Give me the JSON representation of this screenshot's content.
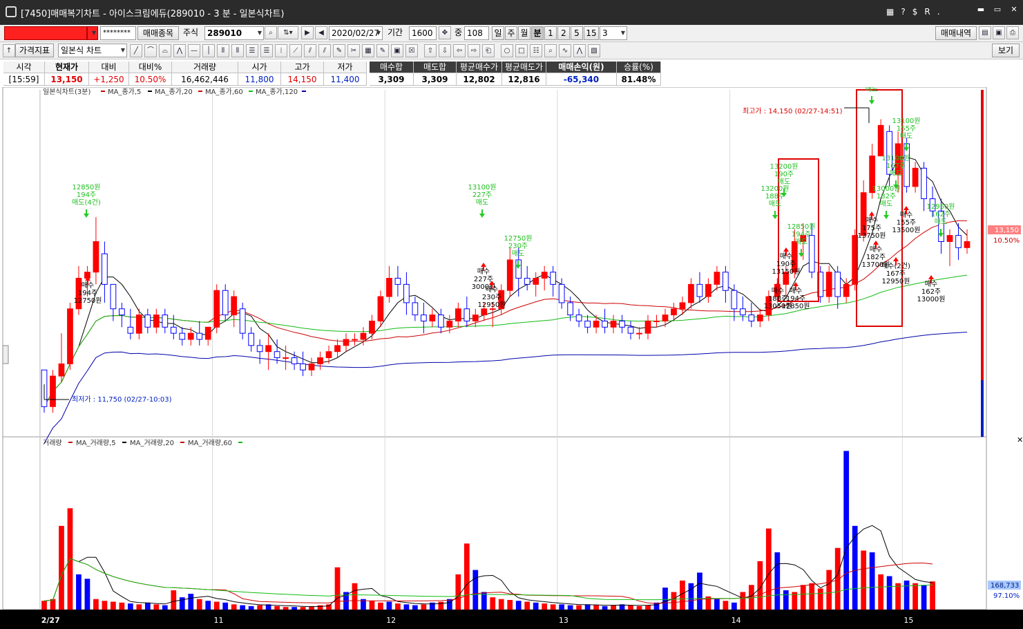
{
  "window": {
    "title": "[7450]매매복기차트 - 아이스크림에듀(289010 - 3 분 - 일본식차트)",
    "tb_icons": [
      "▦",
      "?",
      "$",
      "R",
      "."
    ],
    "controls": [
      "▬",
      "▭",
      "✕"
    ]
  },
  "toolbar1": {
    "password_mask": "********",
    "trade_item_button": "매매종목",
    "market_label": "주식",
    "code": "289010",
    "date": "2020/02/27",
    "period_label": "기간",
    "period_value": "1600",
    "overlap_label": "중",
    "overlap_value": "108",
    "units": [
      "일",
      "주",
      "월",
      "분",
      "1",
      "2",
      "5",
      "15",
      "3"
    ],
    "active_unit": "분",
    "history_button": "매매내역"
  },
  "toolbar2": {
    "indicator_button": "가격지표",
    "chart_type": "일본식 차트",
    "view_button": "보기"
  },
  "info_table": {
    "headers": [
      "시각",
      "현재가",
      "대비",
      "대비%",
      "거래량",
      "시가",
      "고가",
      "저가",
      "매수합",
      "매도합",
      "평균매수가",
      "평균매도가",
      "매매손익(원)",
      "승률(%)"
    ],
    "values": [
      "[15:59]",
      "13,150",
      "+1,250",
      "10.50%",
      "16,462,446",
      "11,800",
      "14,150",
      "11,400",
      "3,309",
      "3,309",
      "12,802",
      "12,816",
      "-65,340",
      "81.48%"
    ]
  },
  "price_legend": {
    "chart": "일본식차트(3분)",
    "ma": [
      "MA_종가,5",
      "MA_종가,20",
      "MA_종가,60",
      "MA_종가,120"
    ]
  },
  "volume_legend": {
    "chart": "거래량",
    "ma": [
      "MA_거래량,5",
      "MA_거래량,20",
      "MA_거래량,60"
    ]
  },
  "price_markers": {
    "high": "최고가 : 14,150 (02/27-14:51)",
    "low": "최저가 : 11,750 (02/27-10:03)",
    "current_price": "13,150",
    "current_pct": "10.50%"
  },
  "volume_markers": {
    "value": "168,733",
    "pct": "97.10%"
  },
  "x_axis_labels": [
    "2/27",
    "11",
    "12",
    "13",
    "14",
    "15"
  ],
  "annotations": [
    {
      "type": "sell",
      "lines": [
        "12850원",
        "194주",
        "매도(4건)"
      ]
    },
    {
      "type": "buy",
      "lines": [
        "매수",
        "194주",
        "12750원"
      ]
    },
    {
      "type": "sell",
      "lines": [
        "13100원",
        "227주",
        "매도"
      ]
    },
    {
      "type": "sell",
      "lines": [
        "12750원",
        "230주",
        "매도"
      ]
    },
    {
      "type": "buy",
      "lines": [
        "매수",
        "227주",
        "3000원"
      ]
    },
    {
      "type": "buy",
      "lines": [
        "매수",
        "230주",
        "12950원"
      ]
    },
    {
      "type": "sell",
      "lines": [
        "13200원",
        "190주",
        "매도"
      ]
    },
    {
      "type": "sell",
      "lines": [
        "13200원",
        "188주",
        "매도"
      ]
    },
    {
      "type": "sell",
      "lines": [
        "12850원",
        "194주",
        "매도"
      ]
    },
    {
      "type": "buy",
      "lines": [
        "매수",
        "190주",
        "13150원"
      ]
    },
    {
      "type": "buy",
      "lines": [
        "매수",
        "188주",
        "13050원"
      ]
    },
    {
      "type": "buy",
      "lines": [
        "매수",
        "194주",
        "12850원"
      ]
    },
    {
      "type": "sell",
      "lines": [
        "매도"
      ]
    },
    {
      "type": "sell",
      "lines": [
        "13100원",
        "155주",
        "매도"
      ]
    },
    {
      "type": "sell",
      "lines": [
        "13100원",
        "167주",
        "매도"
      ]
    },
    {
      "type": "sell",
      "lines": [
        "13000원",
        "182주",
        "매도"
      ]
    },
    {
      "type": "sell",
      "lines": [
        "12950원",
        "162주",
        "매도"
      ]
    },
    {
      "type": "buy",
      "lines": [
        "매수",
        "175주",
        "13750원"
      ]
    },
    {
      "type": "buy",
      "lines": [
        "매수",
        "182주",
        "13700원"
      ]
    },
    {
      "type": "buy",
      "lines": [
        "매수",
        "155주",
        "13500원"
      ]
    },
    {
      "type": "buy",
      "lines": [
        "매수(2건)",
        "167주",
        "12950원"
      ]
    },
    {
      "type": "buy",
      "lines": [
        "매수",
        "162주",
        "13000원"
      ]
    }
  ],
  "colors": {
    "up": "#ff0000",
    "down": "#0000ff",
    "ma5": "#000000",
    "ma20": "#cc0000",
    "ma60": "#11bb11",
    "ma120": "#0000aa",
    "buy_arrow": "#ff0000",
    "sell_arrow": "#22cc22"
  },
  "chart_data": [
    {
      "type": "candlestick",
      "title": "일본식차트(3분)",
      "ylim": [
        11700,
        14300
      ],
      "x_labels": [
        "2/27",
        "11",
        "12",
        "13",
        "14",
        "15"
      ],
      "series": [
        {
          "name": "MA_종가,5"
        },
        {
          "name": "MA_종가,20"
        },
        {
          "name": "MA_종가,60"
        },
        {
          "name": "MA_종가,120"
        }
      ],
      "ohlc": [
        [
          12100,
          12100,
          11750,
          11800
        ],
        [
          11800,
          12100,
          11750,
          12050
        ],
        [
          12050,
          12400,
          12000,
          12150
        ],
        [
          12150,
          12650,
          12100,
          12600
        ],
        [
          12600,
          12950,
          12550,
          12850
        ],
        [
          12850,
          12950,
          12700,
          12900
        ],
        [
          12900,
          13350,
          12800,
          13150
        ],
        [
          13050,
          13150,
          12650,
          12800
        ],
        [
          12800,
          12800,
          12500,
          12600
        ],
        [
          12600,
          12650,
          12450,
          12550
        ],
        [
          12450,
          12600,
          12350,
          12400
        ],
        [
          12400,
          12600,
          12350,
          12550
        ],
        [
          12550,
          12600,
          12400,
          12450
        ],
        [
          12450,
          12600,
          12400,
          12550
        ],
        [
          12550,
          12600,
          12400,
          12450
        ],
        [
          12450,
          12550,
          12350,
          12400
        ],
        [
          12400,
          12450,
          12300,
          12350
        ],
        [
          12350,
          12450,
          12300,
          12400
        ],
        [
          12400,
          12500,
          12300,
          12350
        ],
        [
          12350,
          12450,
          12300,
          12450
        ],
        [
          12450,
          12800,
          12400,
          12750
        ],
        [
          12750,
          12800,
          12500,
          12550
        ],
        [
          12550,
          12750,
          12450,
          12700
        ],
        [
          12600,
          12650,
          12350,
          12400
        ],
        [
          12400,
          12450,
          12250,
          12300
        ],
        [
          12300,
          12350,
          12150,
          12250
        ],
        [
          12250,
          12400,
          12100,
          12300
        ],
        [
          12250,
          12350,
          12150,
          12200
        ],
        [
          12200,
          12300,
          12100,
          12200
        ],
        [
          12200,
          12250,
          12100,
          12150
        ],
        [
          12150,
          12250,
          12050,
          12100
        ],
        [
          12100,
          12200,
          12050,
          12150
        ],
        [
          12150,
          12250,
          12100,
          12200
        ],
        [
          12200,
          12300,
          12150,
          12250
        ],
        [
          12250,
          12350,
          12200,
          12300
        ],
        [
          12300,
          12400,
          12250,
          12350
        ],
        [
          12350,
          12400,
          12300,
          12350
        ],
        [
          12350,
          12450,
          12300,
          12400
        ],
        [
          12400,
          12550,
          12350,
          12500
        ],
        [
          12500,
          12750,
          12450,
          12700
        ],
        [
          12700,
          12950,
          12650,
          12850
        ],
        [
          12850,
          12950,
          12700,
          12800
        ],
        [
          12800,
          12900,
          12550,
          12650
        ],
        [
          12650,
          12700,
          12500,
          12550
        ],
        [
          12550,
          12650,
          12400,
          12500
        ],
        [
          12500,
          12600,
          12450,
          12550
        ],
        [
          12550,
          12600,
          12400,
          12450
        ],
        [
          12450,
          12550,
          12400,
          12500
        ],
        [
          12500,
          12650,
          12450,
          12600
        ],
        [
          12600,
          12700,
          12450,
          12500
        ],
        [
          12500,
          12600,
          12450,
          12550
        ],
        [
          12550,
          12650,
          12500,
          12600
        ],
        [
          12600,
          12650,
          12450,
          12600
        ],
        [
          12600,
          12800,
          12550,
          12750
        ],
        [
          12750,
          13100,
          12700,
          13000
        ],
        [
          13000,
          13100,
          12700,
          12850
        ],
        [
          12850,
          12950,
          12750,
          12800
        ],
        [
          12800,
          12900,
          12700,
          12850
        ],
        [
          12850,
          12950,
          12750,
          12900
        ],
        [
          12900,
          12950,
          12700,
          12800
        ],
        [
          12800,
          12850,
          12600,
          12650
        ],
        [
          12650,
          12700,
          12500,
          12550
        ],
        [
          12550,
          12600,
          12450,
          12500
        ],
        [
          12500,
          12550,
          12400,
          12450
        ],
        [
          12450,
          12550,
          12400,
          12500
        ],
        [
          12500,
          12600,
          12400,
          12450
        ],
        [
          12450,
          12550,
          12400,
          12500
        ],
        [
          12500,
          12550,
          12400,
          12450
        ],
        [
          12450,
          12500,
          12350,
          12400
        ],
        [
          12400,
          12450,
          12350,
          12400
        ],
        [
          12400,
          12550,
          12350,
          12500
        ],
        [
          12500,
          12550,
          12450,
          12500
        ],
        [
          12500,
          12600,
          12450,
          12550
        ],
        [
          12550,
          12650,
          12500,
          12600
        ],
        [
          12600,
          12700,
          12550,
          12650
        ],
        [
          12650,
          12850,
          12600,
          12800
        ],
        [
          12800,
          12900,
          12650,
          12700
        ],
        [
          12700,
          12850,
          12650,
          12800
        ],
        [
          12800,
          12950,
          12750,
          12900
        ],
        [
          12900,
          12950,
          12650,
          12750
        ],
        [
          12750,
          12800,
          12500,
          12600
        ],
        [
          12600,
          12700,
          12500,
          12550
        ],
        [
          12550,
          12650,
          12450,
          12500
        ],
        [
          12500,
          12600,
          12450,
          12550
        ],
        [
          12550,
          12750,
          12500,
          12700
        ],
        [
          12700,
          12850,
          12650,
          12800
        ],
        [
          12800,
          12950,
          12700,
          12900
        ],
        [
          12900,
          13250,
          12850,
          13150
        ],
        [
          13150,
          13300,
          13000,
          13200
        ],
        [
          13200,
          13300,
          12850,
          12900
        ],
        [
          12900,
          12950,
          12650,
          12700
        ],
        [
          12700,
          12950,
          12650,
          12900
        ],
        [
          12900,
          12950,
          12600,
          12700
        ],
        [
          12700,
          12850,
          12650,
          12800
        ],
        [
          12800,
          13250,
          12750,
          13200
        ],
        [
          13200,
          13650,
          13150,
          13550
        ],
        [
          13550,
          13950,
          13500,
          13850
        ],
        [
          13850,
          14150,
          13850,
          14100
        ],
        [
          14050,
          14100,
          13600,
          13700
        ],
        [
          13700,
          14050,
          13550,
          13950
        ],
        [
          13950,
          14000,
          13550,
          13600
        ],
        [
          13600,
          13800,
          13550,
          13750
        ],
        [
          13750,
          13800,
          13400,
          13500
        ],
        [
          13500,
          13600,
          13350,
          13400
        ],
        [
          13400,
          13500,
          13050,
          13150
        ],
        [
          13150,
          13250,
          12950,
          13200
        ],
        [
          13200,
          13300,
          13000,
          13100
        ],
        [
          13100,
          13250,
          13050,
          13150
        ]
      ]
    },
    {
      "type": "bar",
      "title": "거래량",
      "series": [
        {
          "name": "MA_거래량,5"
        },
        {
          "name": "MA_거래량,20"
        },
        {
          "name": "MA_거래량,60"
        }
      ],
      "values": [
        10,
        12,
        95,
        115,
        40,
        35,
        12,
        10,
        9,
        8,
        7,
        6,
        8,
        6,
        5,
        22,
        14,
        18,
        12,
        10,
        9,
        8,
        6,
        5,
        4,
        5,
        6,
        4,
        3,
        3,
        3,
        4,
        5,
        6,
        48,
        20,
        30,
        12,
        10,
        8,
        9,
        7,
        6,
        5,
        6,
        8,
        9,
        12,
        40,
        75,
        45,
        20,
        14,
        12,
        11,
        10,
        9,
        8,
        7,
        6,
        6,
        5,
        5,
        6,
        5,
        4,
        5,
        6,
        5,
        4,
        5,
        8,
        25,
        20,
        33,
        30,
        42,
        15,
        12,
        10,
        8,
        20,
        28,
        55,
        92,
        65,
        22,
        20,
        28,
        30,
        24,
        45,
        70,
        180,
        95,
        67,
        65,
        40,
        38,
        30,
        33,
        30,
        28,
        32
      ],
      "up": [
        1,
        1,
        1,
        1,
        0,
        0,
        1,
        1,
        1,
        1,
        0,
        1,
        0,
        1,
        0,
        1,
        0,
        0,
        1,
        0,
        1,
        0,
        1,
        0,
        0,
        1,
        0,
        1,
        1,
        0,
        1,
        1,
        1,
        1,
        1,
        0,
        1,
        0,
        1,
        1,
        0,
        1,
        0,
        0,
        1,
        0,
        1,
        0,
        1,
        1,
        0,
        0,
        1,
        1,
        1,
        0,
        1,
        0,
        1,
        1,
        0,
        0,
        1,
        0,
        1,
        0,
        1,
        0,
        1,
        1,
        1,
        0,
        0,
        1,
        1,
        0,
        0,
        1,
        0,
        1,
        0,
        1,
        1,
        1,
        1,
        0,
        0,
        1,
        1,
        1,
        1,
        1,
        1,
        0,
        0,
        1,
        0,
        1,
        0,
        1,
        0,
        1,
        0,
        1
      ]
    }
  ]
}
